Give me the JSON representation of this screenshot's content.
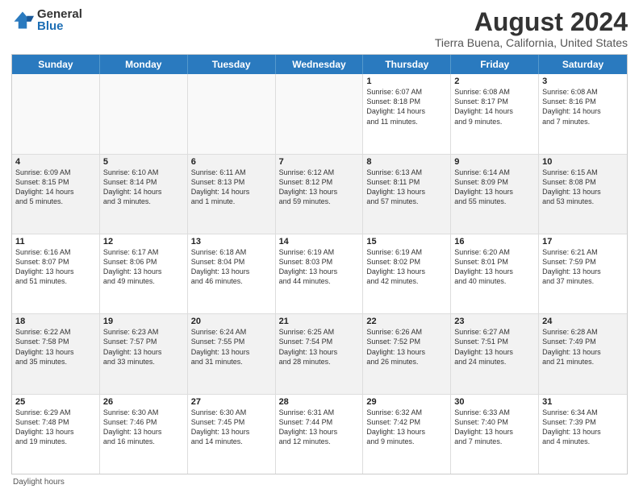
{
  "logo": {
    "general": "General",
    "blue": "Blue",
    "icon_color": "#2a7abf"
  },
  "title": "August 2024",
  "subtitle": "Tierra Buena, California, United States",
  "header_days": [
    "Sunday",
    "Monday",
    "Tuesday",
    "Wednesday",
    "Thursday",
    "Friday",
    "Saturday"
  ],
  "footer": "Daylight hours",
  "weeks": [
    [
      {
        "day": "",
        "info": ""
      },
      {
        "day": "",
        "info": ""
      },
      {
        "day": "",
        "info": ""
      },
      {
        "day": "",
        "info": ""
      },
      {
        "day": "1",
        "info": "Sunrise: 6:07 AM\nSunset: 8:18 PM\nDaylight: 14 hours\nand 11 minutes."
      },
      {
        "day": "2",
        "info": "Sunrise: 6:08 AM\nSunset: 8:17 PM\nDaylight: 14 hours\nand 9 minutes."
      },
      {
        "day": "3",
        "info": "Sunrise: 6:08 AM\nSunset: 8:16 PM\nDaylight: 14 hours\nand 7 minutes."
      }
    ],
    [
      {
        "day": "4",
        "info": "Sunrise: 6:09 AM\nSunset: 8:15 PM\nDaylight: 14 hours\nand 5 minutes."
      },
      {
        "day": "5",
        "info": "Sunrise: 6:10 AM\nSunset: 8:14 PM\nDaylight: 14 hours\nand 3 minutes."
      },
      {
        "day": "6",
        "info": "Sunrise: 6:11 AM\nSunset: 8:13 PM\nDaylight: 14 hours\nand 1 minute."
      },
      {
        "day": "7",
        "info": "Sunrise: 6:12 AM\nSunset: 8:12 PM\nDaylight: 13 hours\nand 59 minutes."
      },
      {
        "day": "8",
        "info": "Sunrise: 6:13 AM\nSunset: 8:11 PM\nDaylight: 13 hours\nand 57 minutes."
      },
      {
        "day": "9",
        "info": "Sunrise: 6:14 AM\nSunset: 8:09 PM\nDaylight: 13 hours\nand 55 minutes."
      },
      {
        "day": "10",
        "info": "Sunrise: 6:15 AM\nSunset: 8:08 PM\nDaylight: 13 hours\nand 53 minutes."
      }
    ],
    [
      {
        "day": "11",
        "info": "Sunrise: 6:16 AM\nSunset: 8:07 PM\nDaylight: 13 hours\nand 51 minutes."
      },
      {
        "day": "12",
        "info": "Sunrise: 6:17 AM\nSunset: 8:06 PM\nDaylight: 13 hours\nand 49 minutes."
      },
      {
        "day": "13",
        "info": "Sunrise: 6:18 AM\nSunset: 8:04 PM\nDaylight: 13 hours\nand 46 minutes."
      },
      {
        "day": "14",
        "info": "Sunrise: 6:19 AM\nSunset: 8:03 PM\nDaylight: 13 hours\nand 44 minutes."
      },
      {
        "day": "15",
        "info": "Sunrise: 6:19 AM\nSunset: 8:02 PM\nDaylight: 13 hours\nand 42 minutes."
      },
      {
        "day": "16",
        "info": "Sunrise: 6:20 AM\nSunset: 8:01 PM\nDaylight: 13 hours\nand 40 minutes."
      },
      {
        "day": "17",
        "info": "Sunrise: 6:21 AM\nSunset: 7:59 PM\nDaylight: 13 hours\nand 37 minutes."
      }
    ],
    [
      {
        "day": "18",
        "info": "Sunrise: 6:22 AM\nSunset: 7:58 PM\nDaylight: 13 hours\nand 35 minutes."
      },
      {
        "day": "19",
        "info": "Sunrise: 6:23 AM\nSunset: 7:57 PM\nDaylight: 13 hours\nand 33 minutes."
      },
      {
        "day": "20",
        "info": "Sunrise: 6:24 AM\nSunset: 7:55 PM\nDaylight: 13 hours\nand 31 minutes."
      },
      {
        "day": "21",
        "info": "Sunrise: 6:25 AM\nSunset: 7:54 PM\nDaylight: 13 hours\nand 28 minutes."
      },
      {
        "day": "22",
        "info": "Sunrise: 6:26 AM\nSunset: 7:52 PM\nDaylight: 13 hours\nand 26 minutes."
      },
      {
        "day": "23",
        "info": "Sunrise: 6:27 AM\nSunset: 7:51 PM\nDaylight: 13 hours\nand 24 minutes."
      },
      {
        "day": "24",
        "info": "Sunrise: 6:28 AM\nSunset: 7:49 PM\nDaylight: 13 hours\nand 21 minutes."
      }
    ],
    [
      {
        "day": "25",
        "info": "Sunrise: 6:29 AM\nSunset: 7:48 PM\nDaylight: 13 hours\nand 19 minutes."
      },
      {
        "day": "26",
        "info": "Sunrise: 6:30 AM\nSunset: 7:46 PM\nDaylight: 13 hours\nand 16 minutes."
      },
      {
        "day": "27",
        "info": "Sunrise: 6:30 AM\nSunset: 7:45 PM\nDaylight: 13 hours\nand 14 minutes."
      },
      {
        "day": "28",
        "info": "Sunrise: 6:31 AM\nSunset: 7:44 PM\nDaylight: 13 hours\nand 12 minutes."
      },
      {
        "day": "29",
        "info": "Sunrise: 6:32 AM\nSunset: 7:42 PM\nDaylight: 13 hours\nand 9 minutes."
      },
      {
        "day": "30",
        "info": "Sunrise: 6:33 AM\nSunset: 7:40 PM\nDaylight: 13 hours\nand 7 minutes."
      },
      {
        "day": "31",
        "info": "Sunrise: 6:34 AM\nSunset: 7:39 PM\nDaylight: 13 hours\nand 4 minutes."
      }
    ]
  ]
}
